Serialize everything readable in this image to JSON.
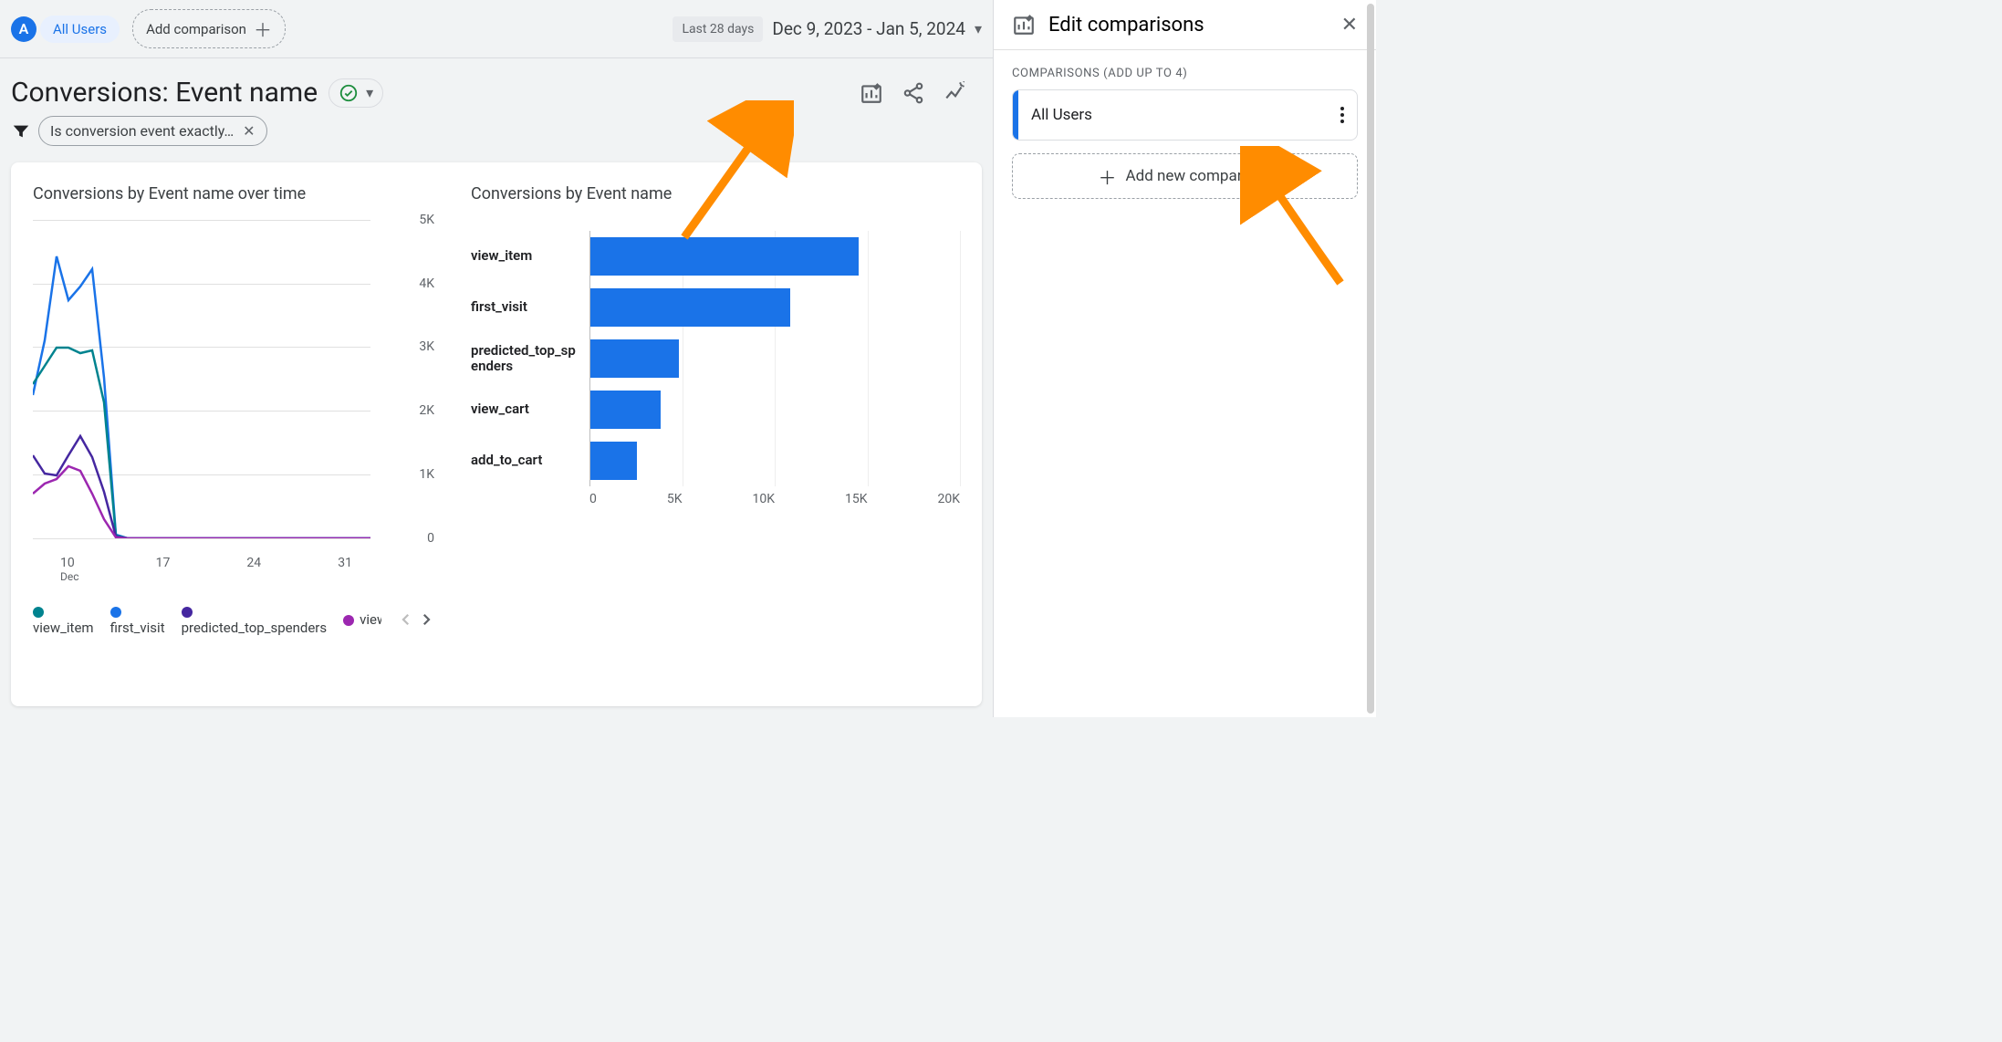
{
  "topbar": {
    "avatar_letter": "A",
    "all_users_label": "All Users",
    "add_comparison_label": "Add comparison",
    "date_label": "Last 28 days",
    "date_range": "Dec 9, 2023 - Jan 5, 2024"
  },
  "title": "Conversions: Event name",
  "filter_text": "Is conversion event exactly…",
  "line_chart_title": "Conversions by Event name over time",
  "bar_chart_title": "Conversions by Event name",
  "y_ticks": [
    "5K",
    "4K",
    "3K",
    "2K",
    "1K",
    "0"
  ],
  "x_ticks": [
    "10",
    "17",
    "24",
    "31"
  ],
  "x_month": "Dec",
  "legend": [
    {
      "label": "view_item",
      "color": "#00838f"
    },
    {
      "label": "first_visit",
      "color": "#1a73e8"
    },
    {
      "label": "predicted_top_spenders",
      "color": "#4527a0"
    },
    {
      "label": "view_c",
      "color": "#9c27b0"
    }
  ],
  "bar_ticks": [
    "0",
    "5K",
    "10K",
    "15K",
    "20K"
  ],
  "side": {
    "title": "Edit comparisons",
    "section": "COMPARISONS (ADD UP TO 4)",
    "item_name": "All Users",
    "add_new": "Add new comparison"
  },
  "chart_data": {
    "line": {
      "type": "line",
      "title": "Conversions by Event name over time",
      "xlabel": "Dec",
      "ylabel": "",
      "ylim": [
        0,
        5000
      ],
      "x": [
        7,
        8,
        9,
        10,
        11,
        12,
        13,
        14,
        15,
        16,
        17,
        18,
        19,
        20,
        21,
        22,
        23,
        24,
        25,
        26,
        27,
        28,
        29,
        30,
        31,
        1,
        2,
        3,
        4,
        5
      ],
      "series": [
        {
          "name": "view_item",
          "color": "#00838f",
          "values": [
            2400,
            2700,
            3000,
            3000,
            2900,
            2950,
            2050,
            50,
            0,
            0,
            0,
            0,
            0,
            0,
            0,
            0,
            0,
            0,
            0,
            0,
            0,
            0,
            0,
            0,
            0,
            0,
            0,
            0,
            0,
            0
          ]
        },
        {
          "name": "first_visit",
          "color": "#1a73e8",
          "values": [
            2250,
            3100,
            4400,
            3700,
            4000,
            4200,
            2500,
            60,
            0,
            0,
            0,
            0,
            0,
            0,
            0,
            0,
            0,
            0,
            0,
            0,
            0,
            0,
            0,
            0,
            0,
            0,
            0,
            0,
            0,
            0
          ]
        },
        {
          "name": "predicted_top_spenders",
          "color": "#4527a0",
          "values": [
            1300,
            1000,
            950,
            1300,
            1600,
            1250,
            700,
            30,
            0,
            0,
            0,
            0,
            0,
            0,
            0,
            0,
            0,
            0,
            0,
            0,
            0,
            0,
            0,
            0,
            0,
            0,
            0,
            0,
            0,
            0
          ]
        },
        {
          "name": "view_cart",
          "color": "#9c27b0",
          "values": [
            700,
            850,
            900,
            1100,
            1050,
            700,
            300,
            20,
            0,
            0,
            0,
            0,
            0,
            0,
            0,
            0,
            0,
            0,
            0,
            0,
            0,
            0,
            0,
            0,
            0,
            0,
            0,
            0,
            0,
            0
          ]
        }
      ]
    },
    "bar": {
      "type": "bar",
      "title": "Conversions by Event name",
      "orientation": "horizontal",
      "xlim": [
        0,
        20000
      ],
      "categories": [
        "view_item",
        "first_visit",
        "predicted_top_spenders",
        "view_cart",
        "add_to_cart"
      ],
      "values": [
        14500,
        10800,
        4800,
        3800,
        2500
      ]
    }
  }
}
